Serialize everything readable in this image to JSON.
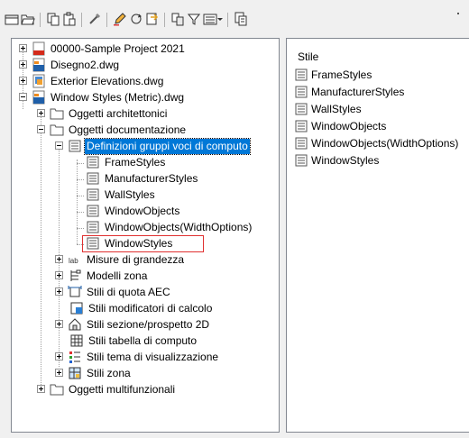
{
  "toolbar": {
    "buttons": [
      "new-drawing-icon",
      "open-folder-icon",
      "copy-icon",
      "paste-icon",
      "purge-icon",
      "edit-icon",
      "sync-icon",
      "import-icon",
      "copy-to-icon",
      "filter-icon",
      "view-mode-icon",
      "dropdown-arrow-icon",
      "preview-icon"
    ]
  },
  "tree": {
    "nodes": [
      {
        "label": "00000-Sample Project 2021",
        "icon": "pdf-file-icon"
      },
      {
        "label": "Disegno2.dwg",
        "icon": "dwg-file-icon"
      },
      {
        "label": "Exterior Elevations.dwg",
        "icon": "dwg-file-icon"
      },
      {
        "label": "Window Styles (Metric).dwg",
        "icon": "dwg-file-icon"
      },
      {
        "label": "Oggetti architettonici",
        "icon": "folder-icon"
      },
      {
        "label": "Oggetti documentazione",
        "icon": "folder-icon"
      },
      {
        "label": "Definizioni gruppi voci di computo",
        "icon": "list-icon"
      },
      {
        "label": "FrameStyles",
        "icon": "list-icon"
      },
      {
        "label": "ManufacturerStyles",
        "icon": "list-icon"
      },
      {
        "label": "WallStyles",
        "icon": "list-icon"
      },
      {
        "label": "WindowObjects",
        "icon": "list-icon"
      },
      {
        "label": "WindowObjects(WidthOptions)",
        "icon": "list-icon"
      },
      {
        "label": "WindowStyles",
        "icon": "list-icon"
      },
      {
        "label": "Misure di grandezza",
        "icon": "lab-icon"
      },
      {
        "label": "Modelli zona",
        "icon": "zone-template-icon"
      },
      {
        "label": "Stili di quota AEC",
        "icon": "dimension-icon"
      },
      {
        "label": "Stili modificatori di calcolo",
        "icon": "calc-modifier-icon"
      },
      {
        "label": "Stili sezione/prospetto 2D",
        "icon": "section-icon"
      },
      {
        "label": "Stili tabella di computo",
        "icon": "table-icon"
      },
      {
        "label": "Stili tema di visualizzazione",
        "icon": "theme-icon"
      },
      {
        "label": "Stili zona",
        "icon": "zone-icon"
      },
      {
        "label": "Oggetti multifunzionali",
        "icon": "folder-icon"
      }
    ]
  },
  "list": {
    "header": "Stile",
    "items": [
      "FrameStyles",
      "ManufacturerStyles",
      "WallStyles",
      "WindowObjects",
      "WindowObjects(WidthOptions)",
      "WindowStyles"
    ]
  }
}
